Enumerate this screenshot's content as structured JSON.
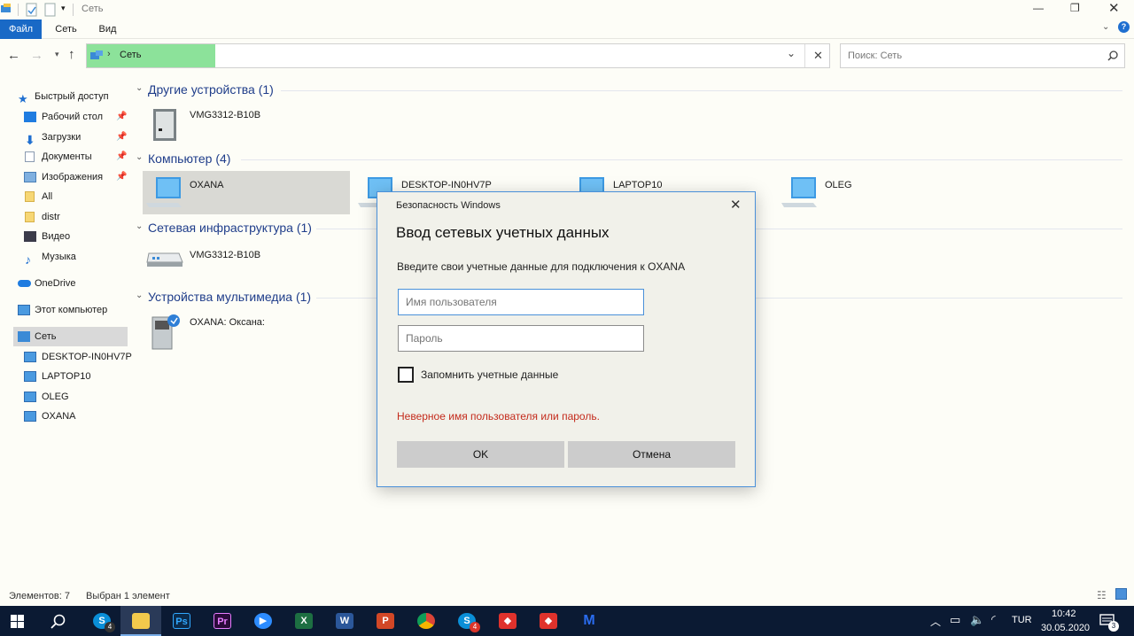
{
  "window": {
    "title": "Сеть",
    "ribbon_tabs": [
      "Файл",
      "Сеть",
      "Вид"
    ]
  },
  "address": {
    "path": "Сеть",
    "search_placeholder": "Поиск: Сеть"
  },
  "sidebar": {
    "items": [
      {
        "label": "Быстрый доступ",
        "icon": "star-icon"
      },
      {
        "label": "Рабочий стол",
        "icon": "desktop-icon",
        "pinned": true
      },
      {
        "label": "Загрузки",
        "icon": "download-icon",
        "pinned": true
      },
      {
        "label": "Документы",
        "icon": "documents-icon",
        "pinned": true
      },
      {
        "label": "Изображения",
        "icon": "pictures-icon",
        "pinned": true
      },
      {
        "label": "All",
        "icon": "folder-icon"
      },
      {
        "label": "distr",
        "icon": "folder-icon"
      },
      {
        "label": "Видео",
        "icon": "video-icon"
      },
      {
        "label": "Музыка",
        "icon": "music-icon"
      },
      {
        "label": "OneDrive",
        "icon": "cloud-icon"
      },
      {
        "label": "Этот компьютер",
        "icon": "computer-icon"
      },
      {
        "label": "Сеть",
        "icon": "network-icon",
        "selected": true
      },
      {
        "label": "DESKTOP-IN0HV7P",
        "icon": "computer-icon"
      },
      {
        "label": "LAPTOP10",
        "icon": "computer-icon"
      },
      {
        "label": "OLEG",
        "icon": "computer-icon"
      },
      {
        "label": "OXANA",
        "icon": "computer-icon"
      }
    ]
  },
  "groups": [
    {
      "title": "Другие устройства (1)",
      "items": [
        "VMG3312-B10B"
      ]
    },
    {
      "title": "Компьютер (4)",
      "items": [
        "OXANA",
        "DESKTOP-IN0HV7P",
        "LAPTOP10",
        "OLEG"
      ]
    },
    {
      "title": "Сетевая инфраструктура (1)",
      "items": [
        "VMG3312-B10B"
      ]
    },
    {
      "title": "Устройства мультимедиа (1)",
      "items": [
        "OXANA: Оксана:"
      ]
    }
  ],
  "dialog": {
    "caption": "Безопасность Windows",
    "heading": "Ввод сетевых учетных данных",
    "instruction": "Введите свои учетные данные для подключения к OXANA",
    "username_placeholder": "Имя пользователя",
    "password_placeholder": "Пароль",
    "remember_label": "Запомнить учетные данные",
    "error": "Неверное имя пользователя или пароль.",
    "ok": "OK",
    "cancel": "Отмена",
    "error_color": "#c42b1c"
  },
  "status": {
    "items_count": "Элементов: 7",
    "selected": "Выбран 1 элемент"
  },
  "taskbar": {
    "language": "TUR",
    "time": "10:42",
    "date": "30.05.2020",
    "notifications": "3",
    "skype_badge_1": "4",
    "skype_badge_2": "4"
  }
}
